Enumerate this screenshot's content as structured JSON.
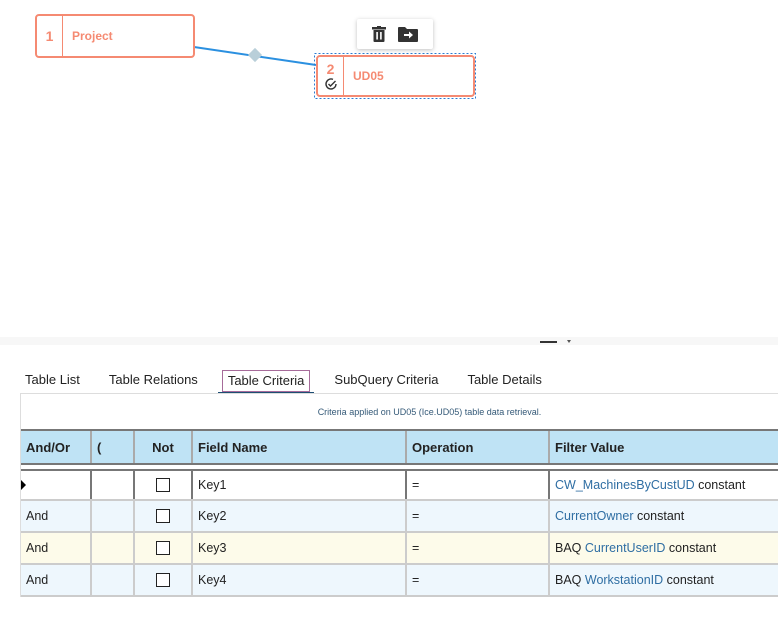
{
  "diagram": {
    "nodes": [
      {
        "num": "1",
        "label": "Project"
      },
      {
        "num": "2",
        "label": "UD05",
        "status": "check-circle"
      }
    ],
    "toolbar": [
      "trash-icon",
      "move-to-folder-icon"
    ]
  },
  "tabs": [
    "Table List",
    "Table Relations",
    "Table Criteria",
    "SubQuery Criteria",
    "Table Details"
  ],
  "active_tab": "Table Criteria",
  "criteria_caption": "Criteria applied on UD05 (Ice.UD05) table data retrieval.",
  "columns": [
    "And/Or",
    "(",
    "Not",
    "Field Name",
    "Operation",
    "Filter Value"
  ],
  "rows": [
    {
      "andor": "",
      "paren": "",
      "not": false,
      "field": "Key1",
      "op": "=",
      "fv": {
        "prefix": "",
        "link": "CW_MachinesByCustUD",
        "suffix": " constant"
      }
    },
    {
      "andor": "And",
      "paren": "",
      "not": false,
      "field": "Key2",
      "op": "=",
      "fv": {
        "prefix": "",
        "link": "CurrentOwner",
        "suffix": " constant"
      }
    },
    {
      "andor": "And",
      "paren": "",
      "not": false,
      "field": "Key3",
      "op": "=",
      "fv": {
        "prefix": "BAQ ",
        "link": "CurrentUserID",
        "suffix": " constant"
      }
    },
    {
      "andor": "And",
      "paren": "",
      "not": false,
      "field": "Key4",
      "op": "=",
      "fv": {
        "prefix": "BAQ ",
        "link": "WorkstationID",
        "suffix": " constant"
      }
    }
  ]
}
